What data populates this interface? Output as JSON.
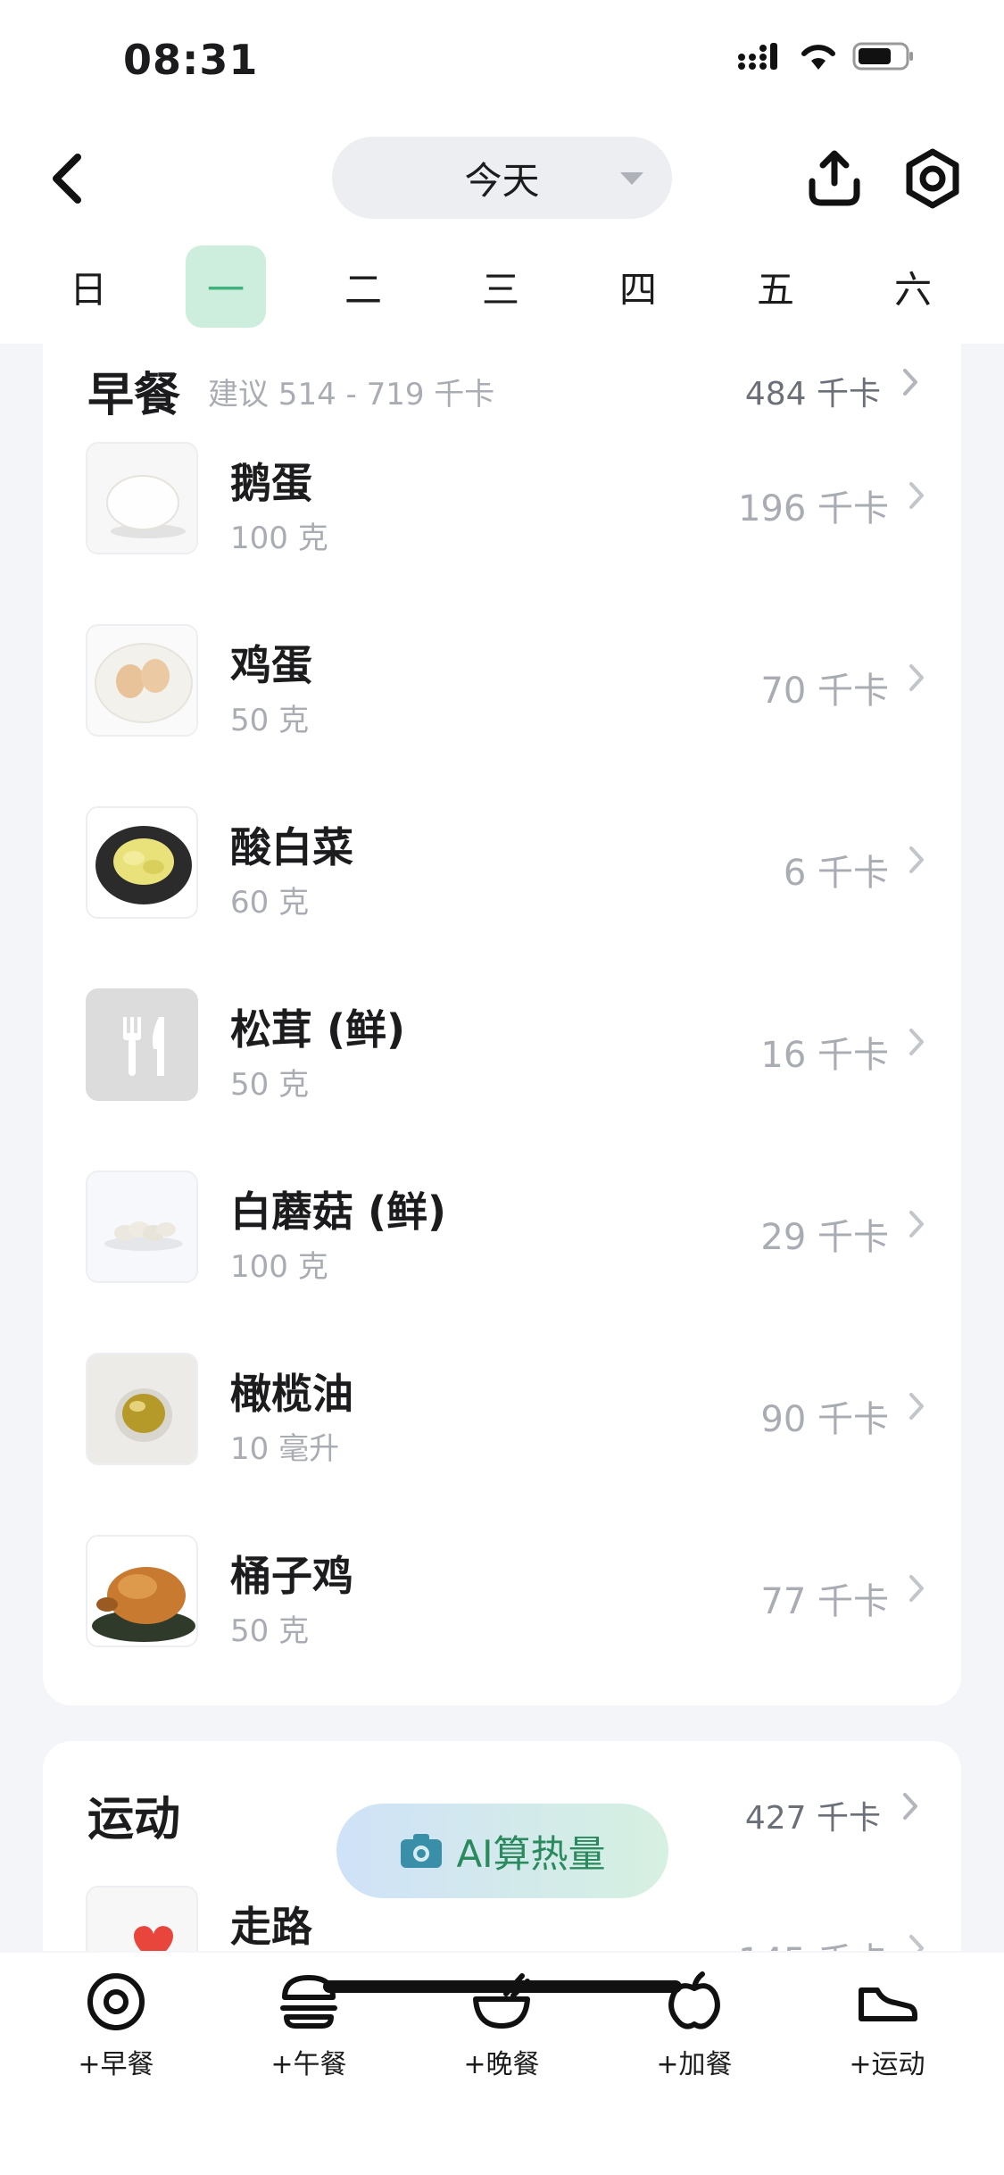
{
  "status": {
    "time": "08:31"
  },
  "header": {
    "date_label": "今天",
    "weekdays": [
      "日",
      "一",
      "二",
      "三",
      "四",
      "五",
      "六"
    ],
    "active_weekday": 1
  },
  "breakfast": {
    "title": "早餐",
    "hint": "建议 514 - 719 千卡",
    "total": "484 千卡",
    "items": [
      {
        "name": "鹅蛋",
        "amount": "100 克",
        "kcal": "196 千卡",
        "thumb": "goose-egg"
      },
      {
        "name": "鸡蛋",
        "amount": "50 克",
        "kcal": "70 千卡",
        "thumb": "eggs-plate"
      },
      {
        "name": "酸白菜",
        "amount": "60 克",
        "kcal": "6 千卡",
        "thumb": "sauerkraut"
      },
      {
        "name": "松茸 (鲜)",
        "amount": "50 克",
        "kcal": "16 千卡",
        "thumb": "utensils-icon"
      },
      {
        "name": "白蘑菇 (鲜)",
        "amount": "100 克",
        "kcal": "29 千卡",
        "thumb": "mushrooms"
      },
      {
        "name": "橄榄油",
        "amount": "10 毫升",
        "kcal": "90 千卡",
        "thumb": "olive-oil"
      },
      {
        "name": "桶子鸡",
        "amount": "50 克",
        "kcal": "77 千卡",
        "thumb": "roast-chicken"
      }
    ]
  },
  "exercise": {
    "title": "运动",
    "total": "427 千卡",
    "items": [
      {
        "name": "走路",
        "kcal": "145 千卡",
        "thumb": "heart-icon"
      }
    ]
  },
  "ai_button": {
    "label": "AI算热量"
  },
  "tabs": [
    {
      "label": "+早餐",
      "icon": "egg-icon"
    },
    {
      "label": "+午餐",
      "icon": "burger-icon"
    },
    {
      "label": "+晚餐",
      "icon": "bowl-icon"
    },
    {
      "label": "+加餐",
      "icon": "apple-icon"
    },
    {
      "label": "+运动",
      "icon": "shoe-icon"
    }
  ],
  "colors": {
    "accent_green": "#3fb27d",
    "active_day_bg": "#cdeedd",
    "muted_text": "#a9acb3",
    "page_bg": "#f4f5f8"
  }
}
